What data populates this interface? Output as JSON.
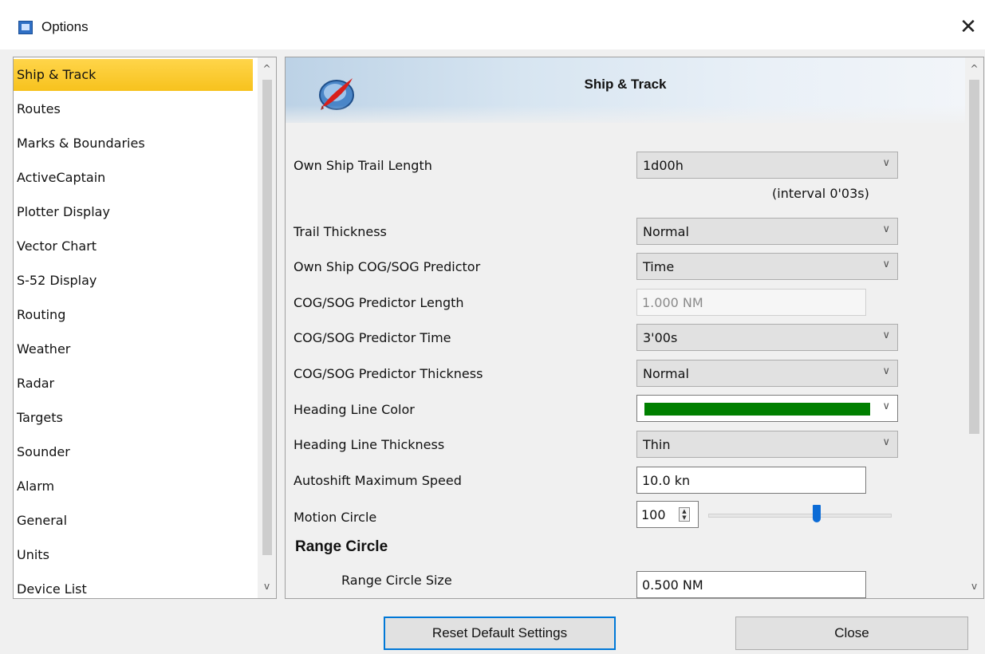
{
  "window": {
    "title": "Options",
    "close_glyph": "✕",
    "app_icon": "options-app-icon"
  },
  "sidebar": {
    "items": [
      {
        "label": "Ship & Track",
        "selected": true
      },
      {
        "label": "Routes"
      },
      {
        "label": "Marks & Boundaries"
      },
      {
        "label": "ActiveCaptain"
      },
      {
        "label": "Plotter Display"
      },
      {
        "label": "Vector Chart"
      },
      {
        "label": "S-52 Display"
      },
      {
        "label": "Routing"
      },
      {
        "label": "Weather"
      },
      {
        "label": "Radar"
      },
      {
        "label": "Targets"
      },
      {
        "label": "Sounder"
      },
      {
        "label": "Alarm"
      },
      {
        "label": "General"
      },
      {
        "label": "Units"
      },
      {
        "label": "Device List"
      }
    ],
    "scroll_up": "^",
    "scroll_down": "v"
  },
  "panel": {
    "header": "Ship & Track",
    "scroll_up": "^",
    "scroll_down": "v",
    "trail_length": {
      "label": "Own Ship Trail Length",
      "value": "1d00h",
      "note": "(interval 0'03s)"
    },
    "trail_thickness": {
      "label": "Trail Thickness",
      "value": "Normal"
    },
    "cog_sog_predictor": {
      "label": "Own Ship COG/SOG Predictor",
      "value": "Time"
    },
    "predictor_length": {
      "label": "COG/SOG Predictor Length",
      "value": "1.000 NM"
    },
    "predictor_time": {
      "label": "COG/SOG Predictor Time",
      "value": "3'00s"
    },
    "predictor_thickness": {
      "label": "COG/SOG Predictor Thickness",
      "value": "Normal"
    },
    "heading_color": {
      "label": "Heading Line Color",
      "color": "#008000"
    },
    "heading_thickness": {
      "label": "Heading Line Thickness",
      "value": "Thin"
    },
    "autoshift": {
      "label": "Autoshift Maximum Speed",
      "value": "10.0 kn"
    },
    "motion_circle": {
      "label": "Motion Circle",
      "value": "100",
      "slider_fraction": 0.59
    },
    "range_circle": {
      "heading": "Range Circle",
      "size_label": "Range Circle Size",
      "size_value": "0.500 NM"
    }
  },
  "buttons": {
    "reset": "Reset Default Settings",
    "close": "Close"
  },
  "colors": {
    "selected_item": "#f7c21d",
    "accent_blue": "#0078d7",
    "heading_line": "#008000"
  }
}
